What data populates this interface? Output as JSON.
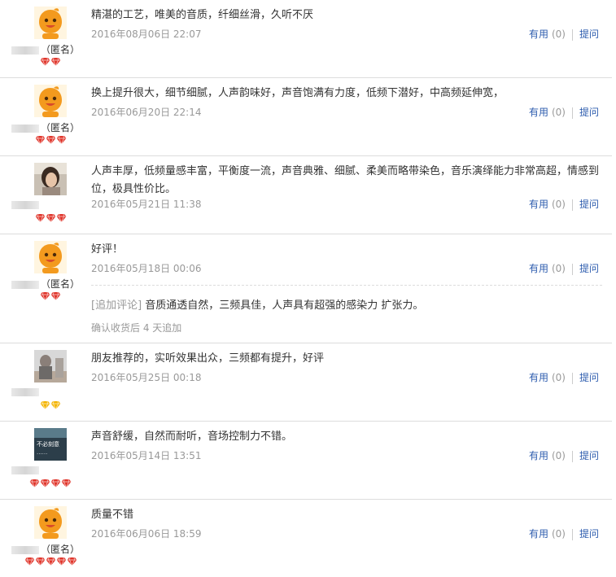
{
  "reviews": [
    {
      "text": "精湛的工艺，唯美的音质，纤细丝滑，久听不厌",
      "date": "2016年08月06日 22:07",
      "anon": "（匿名）",
      "useful": "有用",
      "count": "(0)",
      "ask": "提问",
      "avatar": "orange",
      "gems": 2
    },
    {
      "text": "换上提升很大，细节细腻，人声韵味好，声音饱满有力度，低频下潜好，中高频延伸宽，",
      "date": "2016年06月20日 22:14",
      "anon": "（匿名）",
      "useful": "有用",
      "count": "(0)",
      "ask": "提问",
      "avatar": "orange",
      "gems": 3
    },
    {
      "text": "人声丰厚，低频量感丰富，平衡度一流，声音典雅、细腻、柔美而略带染色，音乐演绎能力非常高超，情感到位，极具性价比。",
      "date": "2016年05月21日 11:38",
      "anon": "",
      "useful": "有用",
      "count": "(0)",
      "ask": "提问",
      "avatar": "photo",
      "gems": 3
    },
    {
      "text": "好评！",
      "date": "2016年05月18日 00:06",
      "anon": "（匿名）",
      "useful": "有用",
      "count": "(0)",
      "ask": "提问",
      "avatar": "orange",
      "gems": 2,
      "append": {
        "tag": "[追加评论]",
        "text": " 音质通透自然，三频具佳，人声具有超强的感染力 扩张力。",
        "note": "确认收货后 4 天追加"
      }
    },
    {
      "text": "朋友推荐的，实听效果出众，三频都有提升，好评",
      "date": "2016年05月25日 00:18",
      "anon": "",
      "useful": "有用",
      "count": "(0)",
      "ask": "提问",
      "avatar": "photo2",
      "gems": 2,
      "gem_color": "gold"
    },
    {
      "text": "声音舒缓，自然而耐听，音场控制力不错。",
      "date": "2016年05月14日 13:51",
      "anon": "",
      "useful": "有用",
      "count": "(0)",
      "ask": "提问",
      "avatar": "dark",
      "avatar_text": "不必刻意",
      "gems": 4
    },
    {
      "text": "质量不错",
      "date": "2016年06月06日 18:59",
      "anon": "（匿名）",
      "useful": "有用",
      "count": "(0)",
      "ask": "提问",
      "avatar": "orange",
      "gems": 5
    }
  ],
  "colors": {
    "link": "#2d5cae",
    "muted": "#999999",
    "text": "#333333",
    "gem_red": "#e0352b",
    "gem_gold": "#f4b400"
  }
}
